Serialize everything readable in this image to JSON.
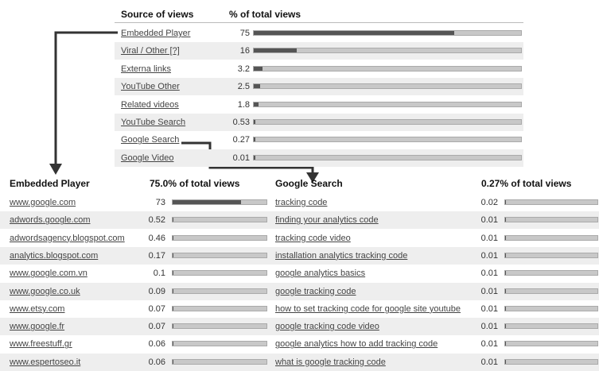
{
  "top": {
    "col_source": "Source of views",
    "col_pct": "% of total views",
    "rows": [
      {
        "label": "Embedded Player",
        "value": "75",
        "fraction": 0.75
      },
      {
        "label": "Viral / Other [?]",
        "value": "16",
        "fraction": 0.16
      },
      {
        "label": "Externa  links",
        "value": "3.2",
        "fraction": 0.032
      },
      {
        "label": "YouTube Other",
        "value": "2.5",
        "fraction": 0.025
      },
      {
        "label": "Related videos",
        "value": "1.8",
        "fraction": 0.018
      },
      {
        "label": "YouTube Search",
        "value": "0.53",
        "fraction": 0.0053
      },
      {
        "label": "Google Search",
        "value": "0.27",
        "fraction": 0.0027
      },
      {
        "label": "Google Video",
        "value": "0.01",
        "fraction": 0.0001
      }
    ]
  },
  "left": {
    "title": "Embedded Player",
    "subtitle": "75.0% of total views",
    "rows": [
      {
        "label": "www.google.com",
        "value": "73",
        "fraction": 0.73
      },
      {
        "label": "adwords.google.com",
        "value": "0.52",
        "fraction": 0.0052
      },
      {
        "label": "adwordsagency.blogspot.com",
        "value": "0.46",
        "fraction": 0.0046
      },
      {
        "label": "analytics.blogspot.com",
        "value": "0.17",
        "fraction": 0.0017
      },
      {
        "label": "www.google.com.vn",
        "value": "0.1",
        "fraction": 0.001
      },
      {
        "label": "www.google.co.uk",
        "value": "0.09",
        "fraction": 0.0009
      },
      {
        "label": "www.etsy.com",
        "value": "0.07",
        "fraction": 0.0007
      },
      {
        "label": "www.google.fr",
        "value": "0.07",
        "fraction": 0.0007
      },
      {
        "label": "www.freestuff.gr",
        "value": "0.06",
        "fraction": 0.0006
      },
      {
        "label": "www.espertoseo.it",
        "value": "0.06",
        "fraction": 0.0006
      }
    ]
  },
  "right": {
    "title": "Google Search",
    "subtitle": "0.27% of total views",
    "rows": [
      {
        "label": "tracking code",
        "value": "0.02",
        "fraction": 0.0002
      },
      {
        "label": "finding your analytics code",
        "value": "0.01",
        "fraction": 0.0001
      },
      {
        "label": "tracking code video",
        "value": "0.01",
        "fraction": 0.0001
      },
      {
        "label": "installation analytics tracking code",
        "value": "0.01",
        "fraction": 0.0001
      },
      {
        "label": "google analytics basics",
        "value": "0.01",
        "fraction": 0.0001
      },
      {
        "label": "google tracking code",
        "value": "0.01",
        "fraction": 0.0001
      },
      {
        "label": "how to set tracking code for google site youtube",
        "value": "0.01",
        "fraction": 0.0001
      },
      {
        "label": "google tracking code video",
        "value": "0.01",
        "fraction": 0.0001
      },
      {
        "label": "google analytics how to add tracking code",
        "value": "0.01",
        "fraction": 0.0001
      },
      {
        "label": "what is google tracking code",
        "value": "0.01",
        "fraction": 0.0001
      }
    ]
  }
}
